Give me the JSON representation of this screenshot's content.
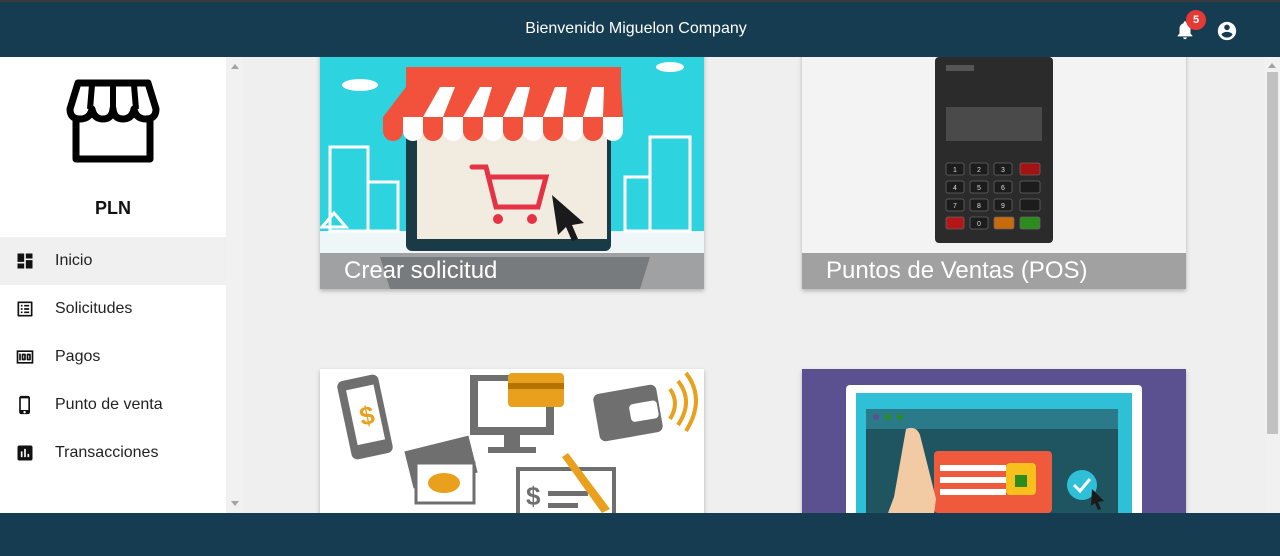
{
  "header": {
    "title": "Bienvenido Miguelon Company",
    "notifications_count": "5",
    "icons": [
      "bell-icon",
      "account-circle-icon"
    ]
  },
  "sidebar": {
    "brand": "PLN",
    "logo_icon": "storefront-icon",
    "items": [
      {
        "label": "Inicio",
        "icon": "dashboard-icon",
        "active": true
      },
      {
        "label": "Solicitudes",
        "icon": "list-icon"
      },
      {
        "label": "Pagos",
        "icon": "money-icon"
      },
      {
        "label": "Punto de venta",
        "icon": "phone-icon"
      },
      {
        "label": "Transacciones",
        "icon": "bar-chart-icon"
      }
    ]
  },
  "cards": [
    {
      "caption": "Crear solicitud",
      "image": "online-store-illustration"
    },
    {
      "caption": "Puntos de Ventas (POS)",
      "image": "pos-terminal-illustration"
    },
    {
      "caption": "",
      "image": "payment-methods-illustration"
    },
    {
      "caption": "",
      "image": "secure-online-payment-illustration"
    }
  ],
  "colors": {
    "topbar": "#163c52",
    "accent_badge": "#e53935"
  }
}
